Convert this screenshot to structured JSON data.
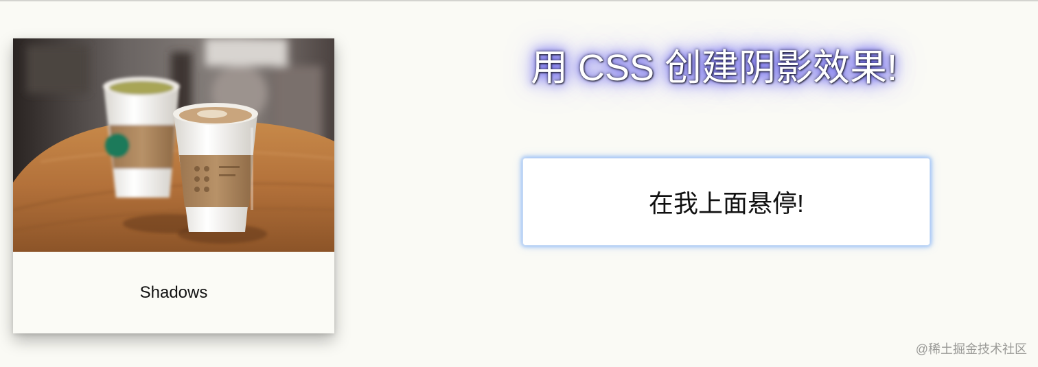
{
  "card": {
    "caption": "Shadows",
    "image_alt": "Two takeaway coffee cups on a wooden table"
  },
  "headline": "用 CSS 创建阴影效果!",
  "hover_box": {
    "label": "在我上面悬停!"
  },
  "watermark": "@稀土掘金技术社区",
  "colors": {
    "page_background": "#fafaf5",
    "headline_glow": "#4c46e8",
    "hover_glow": "#64a0f5"
  }
}
